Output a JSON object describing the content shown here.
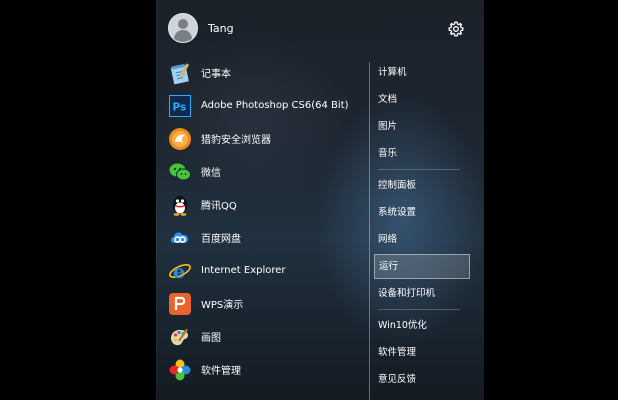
{
  "user": {
    "name": "Tang"
  },
  "icons": {
    "settings": "gear-icon",
    "avatar": "user-avatar-icon"
  },
  "apps": [
    {
      "label": "记事本",
      "icon": "notepad-icon"
    },
    {
      "label": "Adobe Photoshop CS6(64 Bit)",
      "icon": "photoshop-icon",
      "icon_text": "Ps"
    },
    {
      "label": "猎豹安全浏览器",
      "icon": "liebao-browser-icon"
    },
    {
      "label": "微信",
      "icon": "wechat-icon"
    },
    {
      "label": "腾讯QQ",
      "icon": "qq-icon"
    },
    {
      "label": "百度网盘",
      "icon": "baidu-netdisk-icon"
    },
    {
      "label": "Internet Explorer",
      "icon": "internet-explorer-icon",
      "icon_text": "e"
    },
    {
      "label": "WPS演示",
      "icon": "wps-presentation-icon"
    },
    {
      "label": "画图",
      "icon": "paint-icon"
    },
    {
      "label": "软件管理",
      "icon": "software-manager-icon"
    }
  ],
  "places": {
    "group1": [
      "计算机",
      "文档",
      "图片",
      "音乐"
    ],
    "group2": [
      "控制面板",
      "系统设置",
      "网络",
      "运行",
      "设备和打印机"
    ],
    "group3": [
      "Win10优化",
      "软件管理",
      "意见反馈"
    ]
  },
  "selected_place": "运行",
  "colors": {
    "photoshop": "#1a3a63",
    "ie": "#2a8de0",
    "wps": "#e8642c",
    "wechat": "#46c43b"
  }
}
